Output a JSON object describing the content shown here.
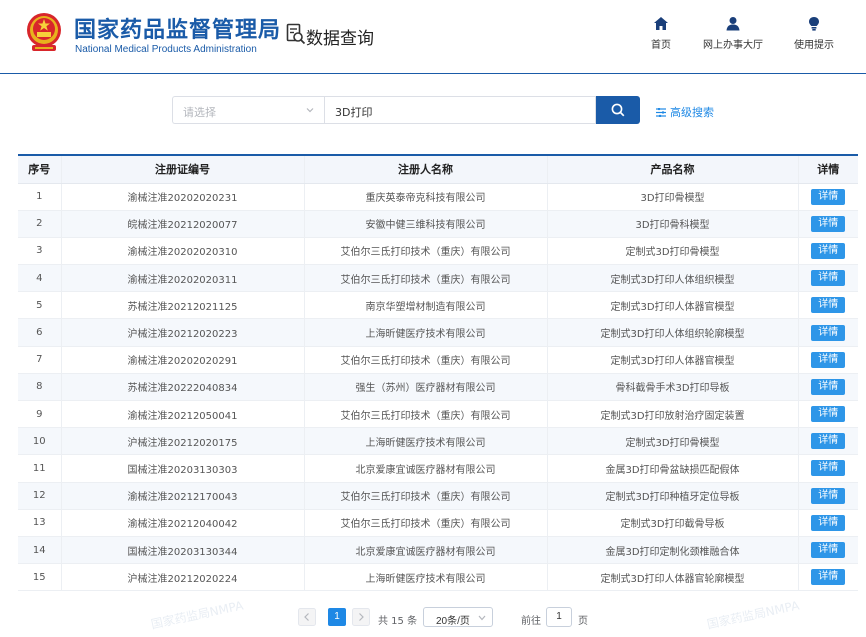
{
  "header": {
    "org_name_cn": "国家药品监督管理局",
    "org_name_en": "National Medical Products Administration",
    "section_title": "数据查询",
    "nav": [
      {
        "label": "首页",
        "icon": "home-icon"
      },
      {
        "label": "网上办事大厅",
        "icon": "user-icon"
      },
      {
        "label": "使用提示",
        "icon": "lightbulb-icon"
      }
    ]
  },
  "search": {
    "select_placeholder": "请选择",
    "query_value": "3D打印",
    "advanced_label": "高级搜索"
  },
  "table": {
    "headers": [
      "序号",
      "注册证编号",
      "注册人名称",
      "产品名称",
      "详情"
    ],
    "detail_label": "详情",
    "rows": [
      [
        "1",
        "渝械注准20202020231",
        "重庆英泰帝克科技有限公司",
        "3D打印骨模型"
      ],
      [
        "2",
        "皖械注准20212020077",
        "安徽中健三维科技有限公司",
        "3D打印骨科模型"
      ],
      [
        "3",
        "渝械注准20202020310",
        "艾伯尔三氐打印技术（重庆）有限公司",
        "定制式3D打印骨模型"
      ],
      [
        "4",
        "渝械注准20202020311",
        "艾伯尔三氐打印技术（重庆）有限公司",
        "定制式3D打印人体组织模型"
      ],
      [
        "5",
        "苏械注准20212021125",
        "南京华塑增材制造有限公司",
        "定制式3D打印人体器官模型"
      ],
      [
        "6",
        "沪械注准20212020223",
        "上海昕健医疗技术有限公司",
        "定制式3D打印人体组织轮廓模型"
      ],
      [
        "7",
        "渝械注准20202020291",
        "艾伯尔三氐打印技术（重庆）有限公司",
        "定制式3D打印人体器官模型"
      ],
      [
        "8",
        "苏械注准20222040834",
        "强生（苏州）医疗器材有限公司",
        "骨科截骨手术3D打印导板"
      ],
      [
        "9",
        "渝械注准20212050041",
        "艾伯尔三氐打印技术（重庆）有限公司",
        "定制式3D打印放射治疗固定装置"
      ],
      [
        "10",
        "沪械注准20212020175",
        "上海昕健医疗技术有限公司",
        "定制式3D打印骨模型"
      ],
      [
        "11",
        "国械注准20203130303",
        "北京爱康宜诚医疗器材有限公司",
        "金属3D打印骨盆缺损匹配假体"
      ],
      [
        "12",
        "渝械注准20212170043",
        "艾伯尔三氐打印技术（重庆）有限公司",
        "定制式3D打印种植牙定位导板"
      ],
      [
        "13",
        "渝械注准20212040042",
        "艾伯尔三氐打印技术（重庆）有限公司",
        "定制式3D打印截骨导板"
      ],
      [
        "14",
        "国械注准20203130344",
        "北京爱康宜诚医疗器材有限公司",
        "金属3D打印定制化颈椎融合体"
      ],
      [
        "15",
        "沪械注准20212020224",
        "上海昕健医疗技术有限公司",
        "定制式3D打印人体器官轮廓模型"
      ]
    ]
  },
  "pagination": {
    "current_page": "1",
    "total_text": "共 15 条",
    "page_size": "20条/页",
    "goto_label": "前往",
    "goto_value": "1",
    "page_unit": "页"
  },
  "watermark_text": "国家药监局NMPA",
  "colors": {
    "brand": "#1a5ba8",
    "accent": "#1e88e5",
    "detail_button": "#2e96e8"
  }
}
